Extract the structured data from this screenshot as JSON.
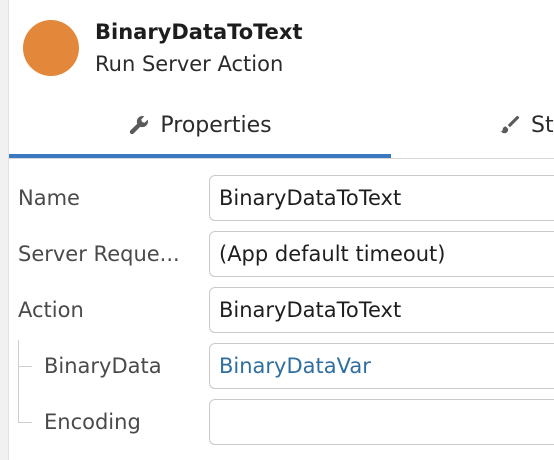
{
  "header": {
    "title": "BinaryDataToText",
    "subtitle": "Run Server Action",
    "avatar_color": "#e3883a"
  },
  "tabs": [
    {
      "label": "Properties",
      "icon": "wrench-icon",
      "active": true
    },
    {
      "label": "St",
      "icon": "brush-icon",
      "active": false
    }
  ],
  "accent_color": "#3b78c2",
  "properties": [
    {
      "label": "Name",
      "value": "BinaryDataToText"
    },
    {
      "label": "Server Reque...",
      "value": "(App default timeout)"
    },
    {
      "label": "Action",
      "value": "BinaryDataToText"
    },
    {
      "label": "BinaryData",
      "value": "BinaryDataVar"
    },
    {
      "label": "Encoding",
      "value": ""
    }
  ]
}
